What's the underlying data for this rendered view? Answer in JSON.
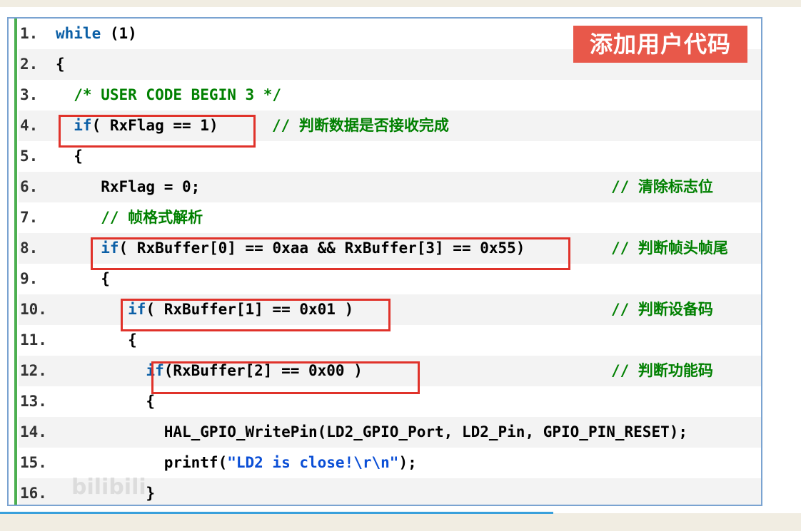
{
  "badge": "添加用户代码",
  "watermark": "bilibili",
  "lines": [
    {
      "num": "1.",
      "parts": [
        {
          "t": "while",
          "c": "kw"
        },
        {
          "t": " (1)",
          "c": ""
        }
      ],
      "comment": ""
    },
    {
      "num": "2.",
      "parts": [
        {
          "t": "{",
          "c": ""
        }
      ],
      "comment": ""
    },
    {
      "num": "3.",
      "parts": [
        {
          "t": "  /* USER CODE BEGIN 3 */",
          "c": "cm"
        }
      ],
      "comment": ""
    },
    {
      "num": "4.",
      "parts": [
        {
          "t": "  if",
          "c": "kw"
        },
        {
          "t": "( RxFlag == 1)",
          "c": ""
        }
      ],
      "comment": "// 判断数据是否接收完成"
    },
    {
      "num": "5.",
      "parts": [
        {
          "t": "  {",
          "c": ""
        }
      ],
      "comment": ""
    },
    {
      "num": "6.",
      "parts": [
        {
          "t": "     RxFlag = 0;",
          "c": ""
        }
      ],
      "comment": "// 清除标志位"
    },
    {
      "num": "7.",
      "parts": [
        {
          "t": "     // 帧格式解析",
          "c": "cm"
        }
      ],
      "comment": ""
    },
    {
      "num": "8.",
      "parts": [
        {
          "t": "     if",
          "c": "kw"
        },
        {
          "t": "( RxBuffer[0] == 0xaa && RxBuffer[3] == 0x55)",
          "c": ""
        }
      ],
      "comment": "// 判断帧头帧尾"
    },
    {
      "num": "9.",
      "parts": [
        {
          "t": "     {",
          "c": ""
        }
      ],
      "comment": ""
    },
    {
      "num": "10.",
      "parts": [
        {
          "t": "        if",
          "c": "kw"
        },
        {
          "t": "( RxBuffer[1] == 0x01 )",
          "c": ""
        }
      ],
      "comment": "// 判断设备码"
    },
    {
      "num": "11.",
      "parts": [
        {
          "t": "        {",
          "c": ""
        }
      ],
      "comment": ""
    },
    {
      "num": "12.",
      "parts": [
        {
          "t": "          if",
          "c": "kw"
        },
        {
          "t": "(RxBuffer[2] == 0x00 )",
          "c": ""
        }
      ],
      "comment": "// 判断功能码"
    },
    {
      "num": "13.",
      "parts": [
        {
          "t": "          {",
          "c": ""
        }
      ],
      "comment": ""
    },
    {
      "num": "14.",
      "parts": [
        {
          "t": "            HAL_GPIO_WritePin(LD2_GPIO_Port, LD2_Pin, GPIO_PIN_RESET);",
          "c": ""
        }
      ],
      "comment": ""
    },
    {
      "num": "15.",
      "parts": [
        {
          "t": "            printf(",
          "c": ""
        },
        {
          "t": "\"LD2 is close!\\r\\n\"",
          "c": "str"
        },
        {
          "t": ");",
          "c": ""
        }
      ],
      "comment": ""
    },
    {
      "num": "16.",
      "parts": [
        {
          "t": "          }",
          "c": ""
        }
      ],
      "comment": ""
    }
  ]
}
